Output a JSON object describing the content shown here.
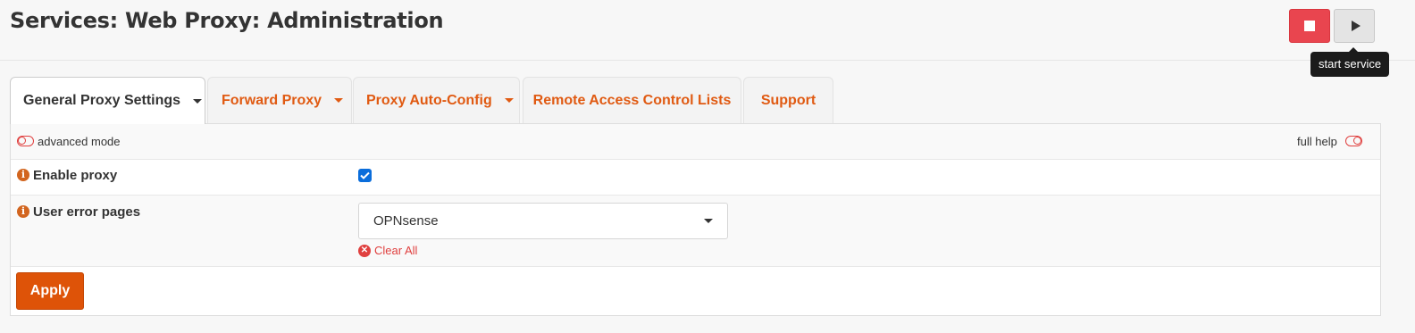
{
  "page": {
    "title": "Services: Web Proxy: Administration"
  },
  "service_controls": {
    "stop_icon": "stop-square-icon",
    "start_icon": "play-icon",
    "tooltip": "start service"
  },
  "tabs": [
    {
      "label": "General Proxy Settings",
      "has_dropdown": true,
      "active": true
    },
    {
      "label": "Forward Proxy",
      "has_dropdown": true,
      "active": false
    },
    {
      "label": "Proxy Auto-Config",
      "has_dropdown": true,
      "active": false
    },
    {
      "label": "Remote Access Control Lists",
      "has_dropdown": false,
      "active": false
    },
    {
      "label": "Support",
      "has_dropdown": false,
      "active": false
    }
  ],
  "form": {
    "advanced_mode_label": "advanced mode",
    "full_help_label": "full help",
    "enable_proxy": {
      "label": "Enable proxy",
      "checked": true
    },
    "user_error_pages": {
      "label": "User error pages",
      "value": "OPNsense",
      "clear_label": "Clear All"
    },
    "apply_label": "Apply"
  },
  "colors": {
    "accent": "#de5308",
    "tab_text": "#e05a12",
    "stop_button": "#e9454f",
    "clear_link": "#e0403f",
    "checkbox": "#0a6ddb"
  }
}
